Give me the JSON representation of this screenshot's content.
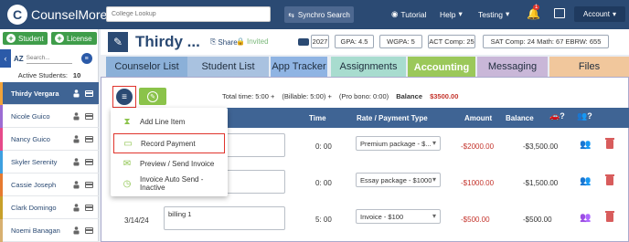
{
  "topnav": {
    "logo_text": "CounselMore",
    "college_search_placeholder": "College Lookup",
    "synchro_label": "Synchro Search",
    "tutorial_label": "Tutorial",
    "help_label": "Help",
    "testing_label": "Testing",
    "notification_count": "1",
    "account_label": "Account"
  },
  "sidebar": {
    "student_button": "Student",
    "license_button": "License",
    "az_label": "AZ",
    "search_placeholder": "Search...",
    "active_label": "Active Students:",
    "active_count": "10",
    "students": [
      {
        "name": "Thirdy Vergara",
        "color": "#f2a33a"
      },
      {
        "name": "Nicole Guico",
        "color": "#9c6cd3"
      },
      {
        "name": "Nancy Guico",
        "color": "#e64a8a"
      },
      {
        "name": "Skyler Serenity",
        "color": "#3ea0e0"
      },
      {
        "name": "Cassie Joseph",
        "color": "#e67a30"
      },
      {
        "name": "Clark Domingo",
        "color": "#c8a02a"
      },
      {
        "name": "Noemi Banagan",
        "color": "#d8b070"
      }
    ]
  },
  "header": {
    "student_name": "Thirdy ...",
    "share_label": "Share",
    "invited_label": "Invited",
    "grad_year": "2027",
    "gpa": "GPA: 4.5",
    "wgpa": "WGPA: 5",
    "act": "ACT Comp: 25",
    "sat": "SAT  Comp: 24  Math: 67  EBRW: 655"
  },
  "tabs": [
    {
      "label": "Counselor List",
      "bg": "#8bb0d8"
    },
    {
      "label": "Student List",
      "bg": "#a9c2e0"
    },
    {
      "label": "App Tracker",
      "bg": "#8fb4e3"
    },
    {
      "label": "Assignments",
      "bg": "#a8dccf"
    },
    {
      "label": "Accounting",
      "bg": "#9bc85a"
    },
    {
      "label": "Messaging",
      "bg": "#c9b7d8"
    },
    {
      "label": "Files",
      "bg": "#f1c79c"
    }
  ],
  "totals": {
    "total_time": "Total time:  5:00  +",
    "billable": "(Billable:  5:00)  +",
    "pro_bono": "(Pro bono:   0:00)",
    "balance_label": "Balance",
    "balance_value": "$3500.00"
  },
  "table": {
    "headers": {
      "time": "Time",
      "rate": "Rate / Payment Type",
      "amount": "Amount",
      "balance": "Balance"
    },
    "rows": [
      {
        "date": "",
        "desc": "",
        "time": "0: 00",
        "pay": "Premium package - $...",
        "amount": "-$2000.00",
        "balance": "-$3,500.00"
      },
      {
        "date": "",
        "desc": "",
        "time": "0: 00",
        "pay": "Essay package - $1000",
        "amount": "-$1000.00",
        "balance": "-$1,500.00"
      },
      {
        "date": "3/14/24",
        "desc": "billing 1",
        "time": "5: 00",
        "pay": "Invoice - $100",
        "amount": "-$500.00",
        "balance": "-$500.00"
      }
    ]
  },
  "dropdown": {
    "items": [
      {
        "label": "Add Line Item",
        "icon": "hourglass-icon"
      },
      {
        "label": "Record Payment",
        "icon": "credit-card-icon"
      },
      {
        "label": "Preview / Send Invoice",
        "icon": "envelope-icon"
      },
      {
        "label": "Invoice Auto Send - Inactive",
        "icon": "clock-icon"
      }
    ]
  },
  "colors": {
    "nav": "#2b4a73",
    "accent_green": "#8bc34a",
    "highlight_red": "#e0342c",
    "negative_amount": "#c4342c"
  }
}
